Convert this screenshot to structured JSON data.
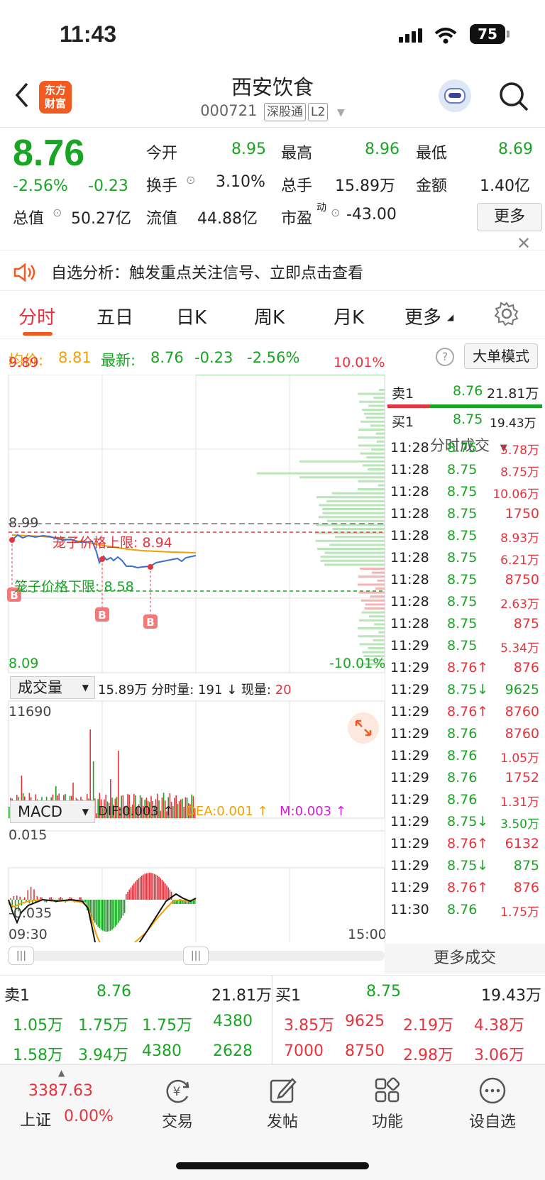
{
  "status_bar": {
    "time": "11:43",
    "battery": "75"
  },
  "header": {
    "title": "西安饮食",
    "code": "000721",
    "tag1": "深股通",
    "tag2": "L2",
    "logo_line1": "东方",
    "logo_line2": "财富"
  },
  "quote": {
    "price": "8.76",
    "change_pct": "-2.56%",
    "change": "-0.23",
    "open_label": "今开",
    "open": "8.95",
    "high_label": "最高",
    "high": "8.96",
    "low_label": "最低",
    "low": "8.69",
    "turnover_label": "换手",
    "turnover": "3.10%",
    "volume_label": "总手",
    "volume": "15.89万",
    "amount_label": "金额",
    "amount": "1.40亿",
    "mktcap_label": "总值",
    "mktcap": "50.27亿",
    "float_label": "流值",
    "float_cap": "44.88亿",
    "pe_label": "市盈",
    "pe_sup": "动",
    "pe": "-43.00",
    "more": "更多"
  },
  "notice": {
    "text": "自选分析：触发重点关注信号、立即点击查看"
  },
  "tabs": [
    "分时",
    "五日",
    "日K",
    "周K",
    "月K",
    "更多"
  ],
  "info_bar": {
    "avg_label": "均价:",
    "avg": "8.81",
    "latest_label": "最新:",
    "latest": "8.76",
    "change": "-0.23",
    "change_pct": "-2.56%",
    "mode": "大单模式"
  },
  "chart": {
    "y_top": "9.89",
    "y_bottom": "8.09",
    "pct_top": "10.01%",
    "pct_bottom": "-10.01%",
    "ref": "8.99",
    "upper_label": "笼子价格上限: 8.94",
    "lower_label": "笼子价格下限: 8.58",
    "vol_select": "成交量",
    "vol_info": "15.89万 分时量: 191 ↓ 现量:",
    "vol_now": "20",
    "vol_max": "11690",
    "macd_select": "MACD",
    "dif": "DIF:0.003 ↑",
    "dea": "DEA:0.001 ↑",
    "m": "M:0.003 ↑",
    "macd_top": "0.015",
    "macd_bottom": "-0.035",
    "t_start": "09:30",
    "t_end": "15:00"
  },
  "side": {
    "ask1_label": "卖1",
    "ask1_price": "8.76",
    "ask1_vol": "21.81万",
    "bid1_label": "买1",
    "bid1_price": "8.75",
    "bid1_vol": "19.43万",
    "ticks_title": "分时成交",
    "ticks": [
      {
        "t": "11:28",
        "p": "8.75",
        "v": "5.78万",
        "pc": "green",
        "vc": "red"
      },
      {
        "t": "11:28",
        "p": "8.75",
        "v": "8.75万",
        "pc": "green",
        "vc": "red"
      },
      {
        "t": "11:28",
        "p": "8.75",
        "v": "10.06万",
        "pc": "green",
        "vc": "red"
      },
      {
        "t": "11:28",
        "p": "8.75",
        "v": "1750",
        "pc": "green",
        "vc": "red"
      },
      {
        "t": "11:28",
        "p": "8.75",
        "v": "8.93万",
        "pc": "green",
        "vc": "red"
      },
      {
        "t": "11:28",
        "p": "8.75",
        "v": "6.21万",
        "pc": "green",
        "vc": "red"
      },
      {
        "t": "11:28",
        "p": "8.75",
        "v": "8750",
        "pc": "green",
        "vc": "red"
      },
      {
        "t": "11:28",
        "p": "8.75",
        "v": "2.63万",
        "pc": "green",
        "vc": "red"
      },
      {
        "t": "11:28",
        "p": "8.75",
        "v": "875",
        "pc": "green",
        "vc": "red"
      },
      {
        "t": "11:29",
        "p": "8.75",
        "v": "5.34万",
        "pc": "green",
        "vc": "red"
      },
      {
        "t": "11:29",
        "p": "8.76↑",
        "v": "876",
        "pc": "red",
        "vc": "red"
      },
      {
        "t": "11:29",
        "p": "8.75↓",
        "v": "9625",
        "pc": "green",
        "vc": "green"
      },
      {
        "t": "11:29",
        "p": "8.76↑",
        "v": "8760",
        "pc": "red",
        "vc": "red"
      },
      {
        "t": "11:29",
        "p": "8.76",
        "v": "8760",
        "pc": "green",
        "vc": "red"
      },
      {
        "t": "11:29",
        "p": "8.76",
        "v": "1.05万",
        "pc": "green",
        "vc": "red"
      },
      {
        "t": "11:29",
        "p": "8.76",
        "v": "1752",
        "pc": "green",
        "vc": "red"
      },
      {
        "t": "11:29",
        "p": "8.76",
        "v": "1.31万",
        "pc": "green",
        "vc": "red"
      },
      {
        "t": "11:29",
        "p": "8.75↓",
        "v": "3.50万",
        "pc": "green",
        "vc": "green"
      },
      {
        "t": "11:29",
        "p": "8.76↑",
        "v": "6132",
        "pc": "red",
        "vc": "red"
      },
      {
        "t": "11:29",
        "p": "8.75↓",
        "v": "875",
        "pc": "green",
        "vc": "green"
      },
      {
        "t": "11:29",
        "p": "8.76↑",
        "v": "876",
        "pc": "red",
        "vc": "red"
      },
      {
        "t": "11:30",
        "p": "8.76",
        "v": "1.75万",
        "pc": "green",
        "vc": "red"
      }
    ],
    "more_ticks": "更多成交"
  },
  "book": {
    "ask_label": "卖1",
    "ask_price": "8.76",
    "ask_vol": "21.81万",
    "bid_label": "买1",
    "bid_price": "8.75",
    "bid_vol": "19.43万",
    "ask_rows": [
      [
        "1.05万",
        "1.75万",
        "1.75万",
        "4380"
      ],
      [
        "1.58万",
        "3.94万",
        "4380",
        "2628"
      ]
    ],
    "bid_rows": [
      [
        "3.85万",
        "9625",
        "2.19万",
        "4.38万"
      ],
      [
        "7000",
        "8750",
        "2.98万",
        "3.06万"
      ]
    ]
  },
  "nav": {
    "index_value": "3387.63",
    "index_name": "上证",
    "index_pct": "0.00%",
    "trade": "交易",
    "post": "发帖",
    "func": "功能",
    "watch": "设自选"
  },
  "colors": {
    "red": "#e8323c",
    "green": "#1aa424",
    "orange": "#f2a100",
    "price_line": "#3a6fd0",
    "avg_line": "#f2a100"
  }
}
